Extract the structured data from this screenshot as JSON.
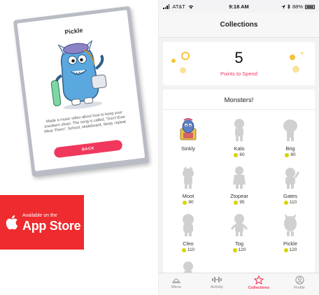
{
  "card": {
    "title": "Pickle",
    "description": "Made a music video about how to keep your sneakers clean. The song is called, \"Don't Ever Wear Them\". School, skateboard, sleep, repeat.",
    "back_label": "BACK"
  },
  "app_store_badge": {
    "small_text": "Available on the",
    "big_text": "App Store"
  },
  "status_bar": {
    "carrier": "AT&T",
    "time": "9:18 AM",
    "battery": "88%"
  },
  "nav": {
    "title": "Collections"
  },
  "points": {
    "value": "5",
    "label": "Points to Spend"
  },
  "monsters": {
    "title": "Monsters!",
    "items": [
      {
        "name": "Sinkly",
        "cost": "",
        "unlocked": true
      },
      {
        "name": "Kalo",
        "cost": "60",
        "unlocked": false
      },
      {
        "name": "Brig",
        "cost": "80",
        "unlocked": false
      },
      {
        "name": "Moot",
        "cost": "90",
        "unlocked": false
      },
      {
        "name": "Ztopear",
        "cost": "95",
        "unlocked": false
      },
      {
        "name": "Gates",
        "cost": "110",
        "unlocked": false
      },
      {
        "name": "Cleo",
        "cost": "110",
        "unlocked": false
      },
      {
        "name": "Tog",
        "cost": "120",
        "unlocked": false
      },
      {
        "name": "Pickle",
        "cost": "120",
        "unlocked": false
      }
    ]
  },
  "tabs": [
    {
      "label": "Menu",
      "icon": "menu-icon",
      "active": false
    },
    {
      "label": "Activity",
      "icon": "activity-icon",
      "active": false
    },
    {
      "label": "Collections",
      "icon": "star-icon",
      "active": true
    },
    {
      "label": "Profile",
      "icon": "profile-icon",
      "active": false
    }
  ],
  "colors": {
    "accent": "#f0385c",
    "coin": "#d7d400",
    "points_dots": "#f5c33a",
    "badge_red": "#ee2b2e"
  }
}
